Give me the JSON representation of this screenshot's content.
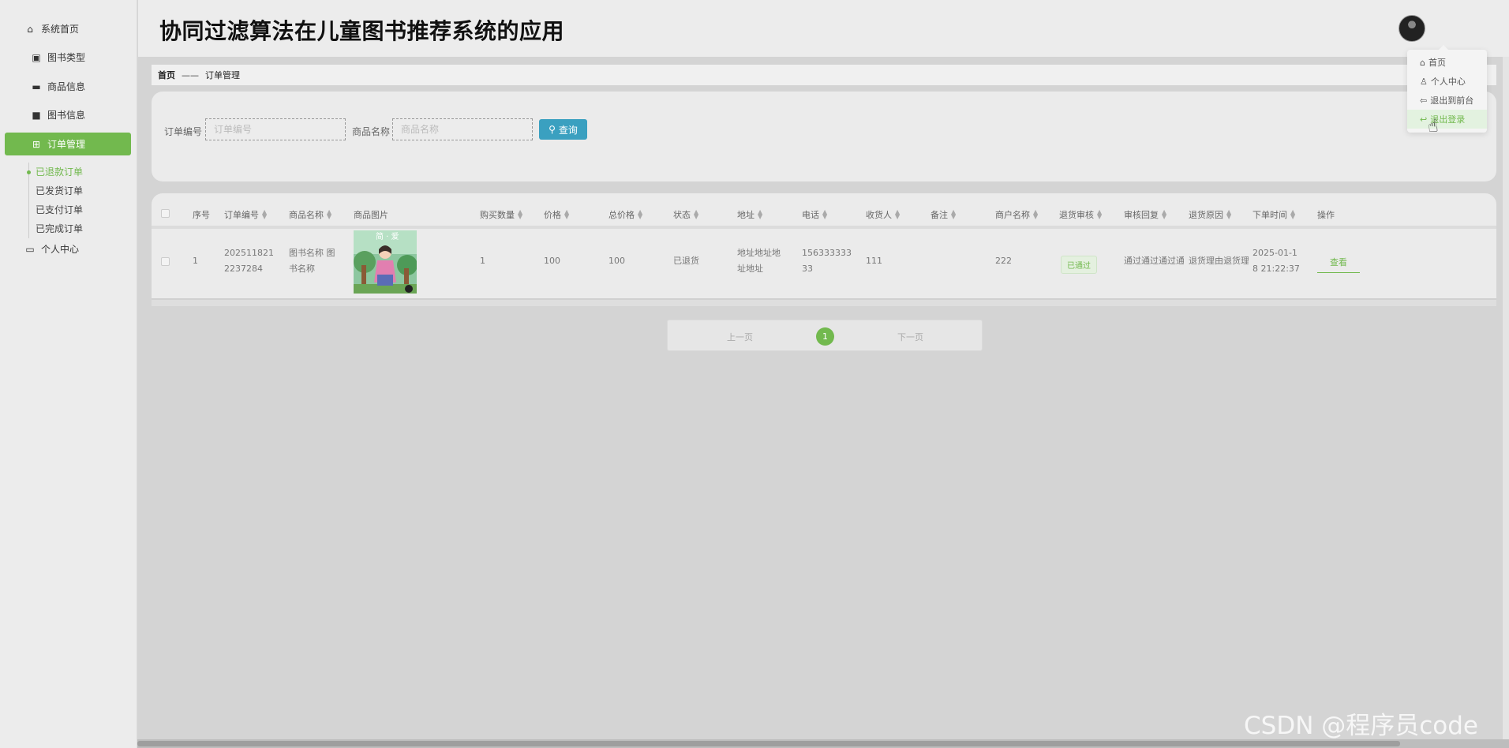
{
  "header": {
    "title": "协同过滤算法在儿童图书推荐系统的应用"
  },
  "sidebar": {
    "items": [
      {
        "label": "系统首页",
        "icon": "home-icon"
      },
      {
        "label": "图书类型",
        "icon": "clipboard-icon"
      },
      {
        "label": "商品信息",
        "icon": "chat-icon"
      },
      {
        "label": "图书信息",
        "icon": "briefcase-icon"
      },
      {
        "label": "订单管理",
        "icon": "grid-icon"
      },
      {
        "label": "个人中心",
        "icon": "card-icon"
      }
    ],
    "submenu": [
      "已退款订单",
      "已发货订单",
      "已支付订单",
      "已完成订单"
    ]
  },
  "breadcrumb": {
    "home": "首页",
    "separator": "——",
    "current": "订单管理"
  },
  "search": {
    "order_label": "订单编号",
    "order_placeholder": "订单编号",
    "name_label": "商品名称",
    "name_placeholder": "商品名称",
    "button_label": "查询"
  },
  "table": {
    "headers": [
      "序号",
      "订单编号",
      "商品名称",
      "商品图片",
      "购买数量",
      "价格",
      "总价格",
      "状态",
      "地址",
      "电话",
      "收货人",
      "备注",
      "商户名称",
      "退货审核",
      "审核回复",
      "退货原因",
      "下单时间",
      "操作"
    ],
    "rows": [
      {
        "index": "1",
        "order_no_1": "202511821",
        "order_no_2": "2237284",
        "name_1": "图书名称 图",
        "name_2": "书名称",
        "quantity": "1",
        "price": "100",
        "total": "100",
        "status": "已退货",
        "address_1": "地址地址地",
        "address_2": "址地址",
        "phone_1": "156333333",
        "phone_2": "33",
        "receiver": "111",
        "remark": "",
        "merchant": "222",
        "audit": "已通过",
        "reply": "通过通过通过通",
        "reason": "退货理由退货理",
        "time_1": "2025-01-1",
        "time_2": "8 21:22:37",
        "action": "查看"
      }
    ]
  },
  "pagination": {
    "prev": "上一页",
    "current": "1",
    "next": "下一页"
  },
  "dropdown": {
    "items": [
      {
        "label": "首页",
        "icon": "home-icon"
      },
      {
        "label": "个人中心",
        "icon": "user-icon"
      },
      {
        "label": "退出到前台",
        "icon": "arrow-left-icon"
      },
      {
        "label": "退出登录",
        "icon": "logout-icon"
      }
    ]
  },
  "watermark": "CSDN @程序员code",
  "colors": {
    "accent": "#72b94e",
    "search_button": "#3aa0c0"
  }
}
